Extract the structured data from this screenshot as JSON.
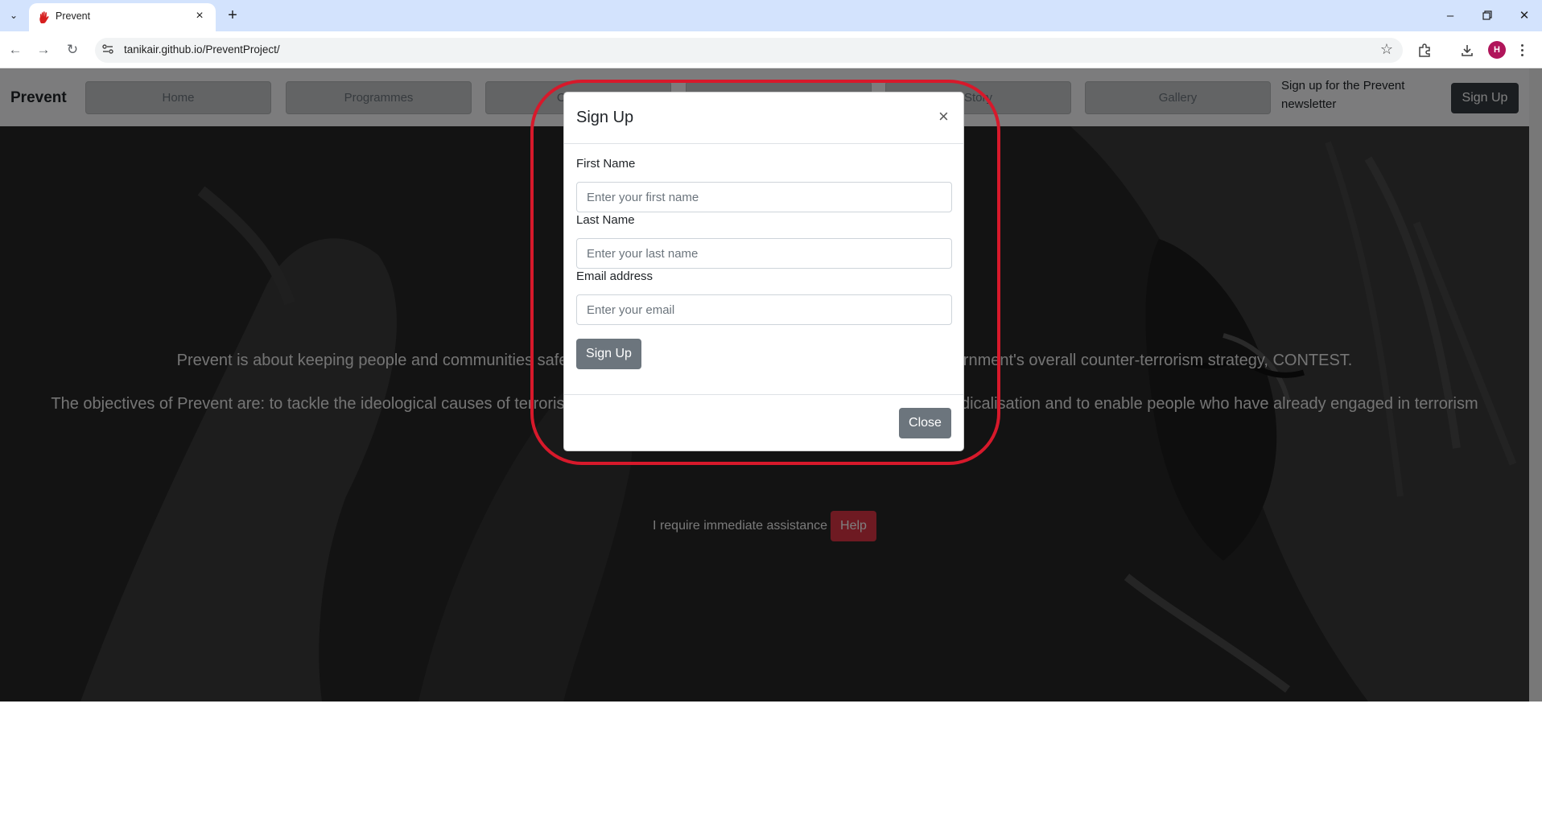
{
  "browser": {
    "tab_title": "Prevent",
    "url": "tanikair.github.io/PreventProject/",
    "profile_initial": "H"
  },
  "page": {
    "brand": "Prevent",
    "nav_items": [
      "Home",
      "Programmes",
      "Counter",
      "",
      "Story",
      "Gallery"
    ],
    "newsletter_text": "Sign up for the Prevent newsletter",
    "nav_signup_label": "Sign Up",
    "hero_paragraph_1": "Prevent is about keeping people and communities safe from the threat of terrorism. Prevent is part of the Government's overall counter-terrorism strategy, CONTEST.",
    "hero_paragraph_2": "The objectives of Prevent are: to tackle the ideological causes of terrorism, to intervene early to support people susceptible to radicalisation and to enable people who have already engaged in terrorism to disengage and rehabilitate.",
    "help_label": "I require immediate assistance",
    "help_button": "Help"
  },
  "modal": {
    "title": "Sign Up",
    "close_symbol": "×",
    "fields": [
      {
        "label": "First Name",
        "placeholder": "Enter your first name"
      },
      {
        "label": "Last Name",
        "placeholder": "Enter your last name"
      },
      {
        "label": "Email address",
        "placeholder": "Enter your email"
      }
    ],
    "submit_label": "Sign Up",
    "close_label": "Close"
  },
  "colors": {
    "annotation_ring": "#d7192b",
    "help_button": "#dc3545",
    "secondary_button": "#6c757d",
    "dark_button": "#343a40",
    "tab_strip": "#d3e3fd"
  }
}
